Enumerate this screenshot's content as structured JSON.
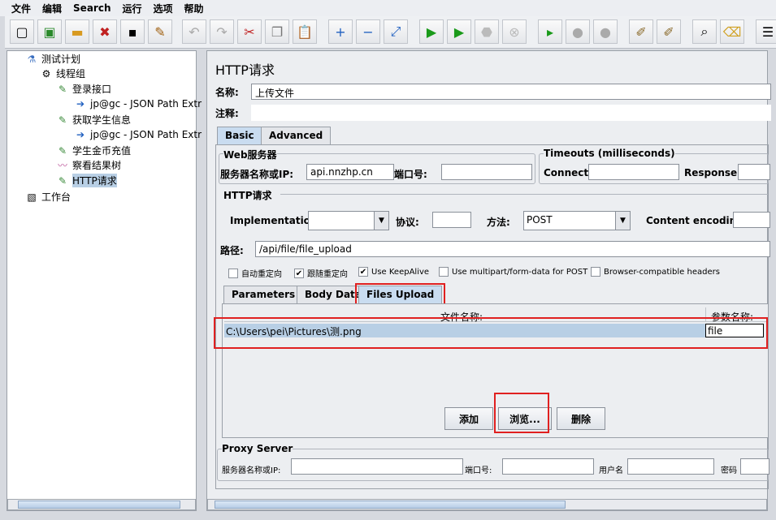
{
  "menu": [
    "文件",
    "编辑",
    "Search",
    "运行",
    "选项",
    "帮助"
  ],
  "toolbar": {
    "icons": [
      "new-icon",
      "templates-icon",
      "open-icon",
      "close-icon",
      "save-icon",
      "save-as-icon",
      "undo-icon",
      "redo-icon",
      "cut-icon",
      "copy-icon",
      "paste-icon",
      "expand-icon",
      "collapse-icon",
      "toggle-icon",
      "start-icon",
      "start-no-pause-icon",
      "stop-icon",
      "shutdown-icon",
      "remote-start-icon",
      "remote-stop-icon",
      "remote-shutdown-icon",
      "clear-icon",
      "clear-all-icon",
      "search-icon",
      "reset-search-icon",
      "function-helper-icon"
    ]
  },
  "tree": [
    {
      "label": "测试计划",
      "icon": "flask-icon"
    },
    {
      "label": "线程组",
      "icon": "gear-icon"
    },
    {
      "label": "登录接口",
      "icon": "sampler-icon"
    },
    {
      "label": "jp@gc - JSON Path Extr",
      "icon": "extractor-icon"
    },
    {
      "label": "获取学生信息",
      "icon": "sampler-icon"
    },
    {
      "label": "jp@gc - JSON Path Extr",
      "icon": "extractor-icon"
    },
    {
      "label": "学生金币充值",
      "icon": "sampler-icon"
    },
    {
      "label": "察看结果树",
      "icon": "listener-icon"
    },
    {
      "label": "HTTP请求",
      "icon": "sampler-icon"
    },
    {
      "label": "工作台",
      "icon": "workbench-icon"
    }
  ],
  "panel": {
    "title": "HTTP请求",
    "name_label": "名称:",
    "name_value": "上传文件",
    "comment_label": "注释:",
    "tabs": [
      "Basic",
      "Advanced"
    ],
    "web_server": {
      "legend": "Web服务器",
      "server_label": "服务器名称或IP:",
      "server_value": "api.nnzhp.cn",
      "port_label": "端口号:"
    },
    "timeouts": {
      "legend": "Timeouts (milliseconds)",
      "connect_label": "Connect:",
      "response_label": "Response:"
    },
    "http": {
      "legend": "HTTP请求",
      "impl_label": "Implementation:",
      "protocol_label": "协议:",
      "method_label": "方法:",
      "method_value": "POST",
      "encoding_label": "Content encoding:",
      "path_label": "路径:",
      "path_value": "/api/file/file_upload"
    },
    "checkboxes": [
      {
        "label": "自动重定向",
        "checked": false
      },
      {
        "label": "跟随重定向",
        "checked": true
      },
      {
        "label": "Use KeepAlive",
        "checked": true
      },
      {
        "label": "Use multipart/form-data for POST",
        "checked": false
      },
      {
        "label": "Browser-compatible headers",
        "checked": false
      }
    ],
    "subtabs": [
      "Parameters",
      "Body Data",
      "Files Upload"
    ],
    "files_table": {
      "headers": [
        "文件名称:",
        "参数名称:"
      ],
      "rows": [
        [
          "C:\\Users\\pei\\Pictures\\测.png",
          "file"
        ]
      ]
    },
    "buttons": [
      "添加",
      "浏览...",
      "删除"
    ],
    "proxy": {
      "legend": "Proxy Server",
      "server_label": "服务器名称或IP:",
      "port_label": "端口号:",
      "user_label": "用户名",
      "password_label": "密码"
    }
  },
  "colors": {
    "highlight": "#e02020",
    "selection": "#b8cfe5"
  }
}
